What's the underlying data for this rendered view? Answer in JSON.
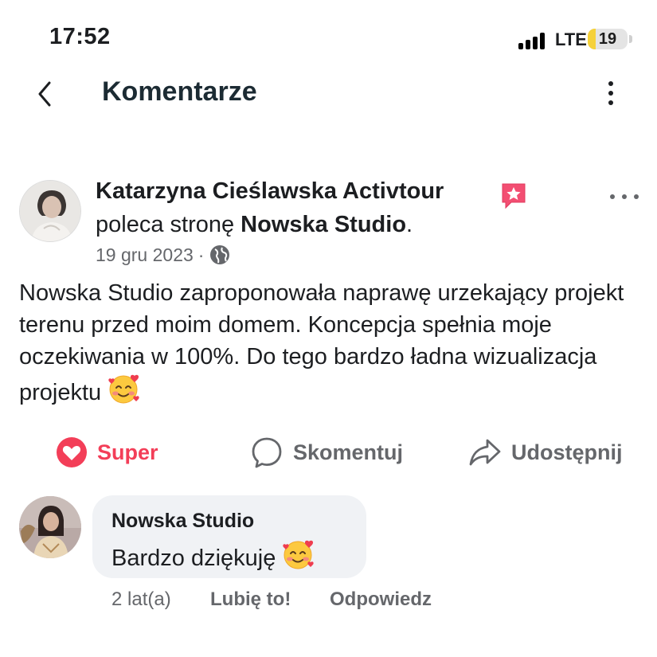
{
  "status_bar": {
    "time": "17:52",
    "network": "LTE",
    "battery": "19",
    "battery_level": 0.19,
    "icons": [
      "signal-icon",
      "battery-icon"
    ]
  },
  "header": {
    "title": "Komentarze",
    "icons": [
      "back-chevron-icon",
      "more-vertical-icon"
    ]
  },
  "post": {
    "author": "Katarzyna Cieślawska Activtour",
    "recommend_prefix": "poleca stronę ",
    "page_name": "Nowska Studio",
    "recommend_suffix": ".",
    "date": "19 gru 2023",
    "separator": "·",
    "body": "Nowska Studio zaproponowała naprawę urzekający projekt terenu przed moim domem. Koncepcja spełnia moje oczekiwania w 100%. Do tego bardzo ładna wizualizacja projektu",
    "icons": [
      "star-badge-icon",
      "more-horizontal-icon",
      "globe-icon",
      "smiling-face-with-hearts-icon"
    ]
  },
  "actions": {
    "super": "Super",
    "comment": "Skomentuj",
    "share": "Udostępnij",
    "icons": [
      "heart-reaction-icon",
      "comment-bubble-icon",
      "share-arrow-icon"
    ],
    "super_color": "#f33e58"
  },
  "comment": {
    "author": "Nowska Studio",
    "text": "Bardzo dziękuję",
    "time": "2 lat(a)",
    "like": "Lubię to!",
    "reply": "Odpowiedz"
  },
  "colors": {
    "text_primary": "#1c1e21",
    "text_secondary": "#65676b",
    "bubble_bg": "#f0f2f5",
    "reaction_red": "#f33e58",
    "battery_yellow": "#f5d13a"
  }
}
